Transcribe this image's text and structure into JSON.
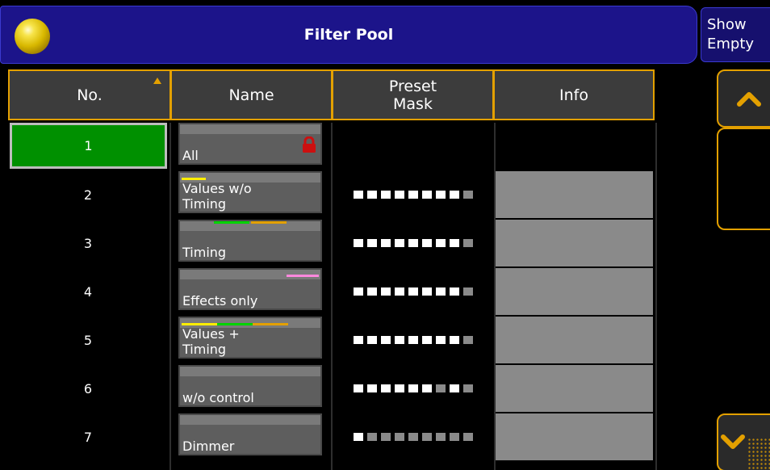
{
  "window": {
    "title": "Filter Pool",
    "show_empty": [
      "Show",
      "Empty"
    ]
  },
  "columns": {
    "no": "No.",
    "name": "Name",
    "preset_mask": "Preset\nMask",
    "info": "Info"
  },
  "sort": {
    "column": "No.",
    "direction": "ascending"
  },
  "rows": [
    {
      "no": "1",
      "name": "All",
      "locked": true,
      "selected": true,
      "mask": null,
      "info": ""
    },
    {
      "no": "2",
      "name": "Values w/o\nTiming",
      "markers": [
        "#ffee00"
      ],
      "mask": [
        1,
        1,
        1,
        1,
        1,
        1,
        1,
        1,
        0
      ],
      "info": ""
    },
    {
      "no": "3",
      "name": "Timing",
      "markers": [
        "#00d400",
        "#e3a000"
      ],
      "mask": [
        1,
        1,
        1,
        1,
        1,
        1,
        1,
        1,
        0
      ],
      "info": ""
    },
    {
      "no": "4",
      "name": "Effects only",
      "markers": [
        "#ff88dd"
      ],
      "mask": [
        1,
        1,
        1,
        1,
        1,
        1,
        1,
        1,
        0
      ],
      "info": ""
    },
    {
      "no": "5",
      "name": "Values +\nTiming",
      "markers": [
        "#ffee00",
        "#00d400",
        "#e3a000"
      ],
      "mask": [
        1,
        1,
        1,
        1,
        1,
        1,
        1,
        1,
        0
      ],
      "info": ""
    },
    {
      "no": "6",
      "name": "w/o control",
      "markers": [],
      "mask": [
        1,
        1,
        1,
        1,
        1,
        1,
        0,
        1,
        0
      ],
      "info": ""
    },
    {
      "no": "7",
      "name": "Dimmer",
      "markers": [],
      "mask": [
        1,
        0,
        0,
        0,
        0,
        0,
        0,
        0,
        0
      ],
      "info": ""
    }
  ],
  "icons": {
    "title": "yellow-ball-icon",
    "lock": "lock-icon",
    "scroll_up": "chevron-up-icon",
    "scroll_down": "chevron-down-icon"
  },
  "colors": {
    "title_bg": "#1c148a",
    "accent": "#e3a000",
    "selected": "#009000",
    "info_bg": "#8a8a8a",
    "lock": "#cc1010"
  }
}
